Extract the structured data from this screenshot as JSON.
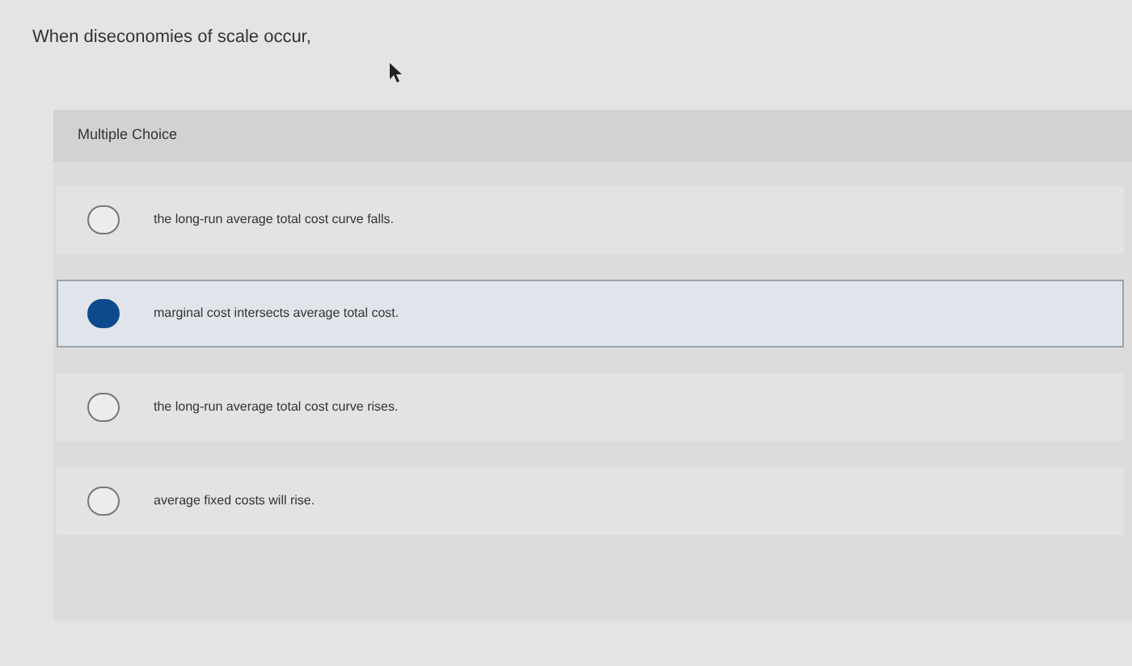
{
  "question": "When diseconomies of scale occur,",
  "section_label": "Multiple Choice",
  "options": [
    {
      "label": "the long-run average total cost curve falls.",
      "selected": false
    },
    {
      "label": "marginal cost intersects average total cost.",
      "selected": true
    },
    {
      "label": "the long-run average total cost curve rises.",
      "selected": false
    },
    {
      "label": "average fixed costs will rise.",
      "selected": false
    }
  ]
}
